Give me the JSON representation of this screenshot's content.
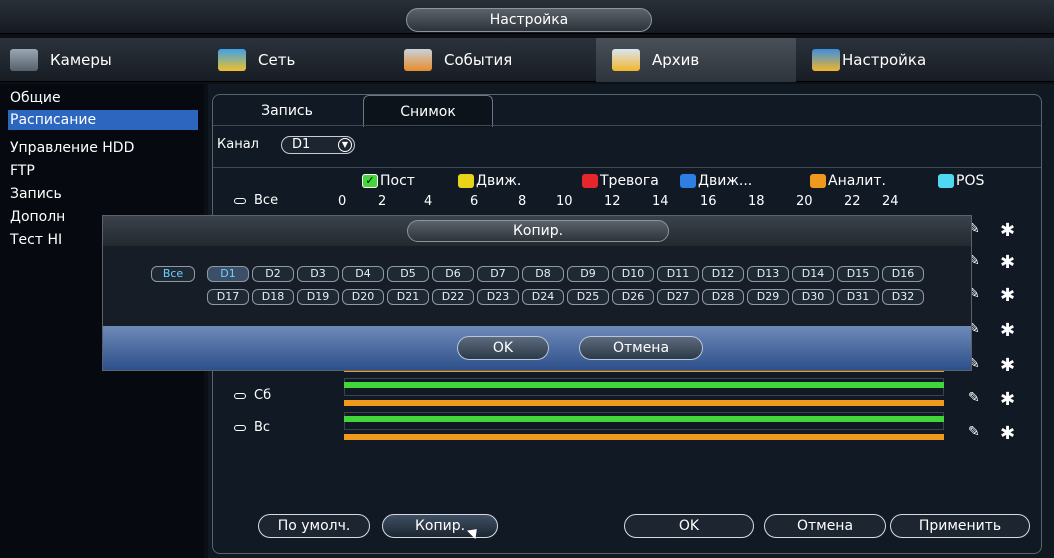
{
  "window": {
    "title": "Настройка"
  },
  "tabs": [
    {
      "label": "Камеры",
      "icon": "camera-icon",
      "active": false
    },
    {
      "label": "Сеть",
      "icon": "network-icon",
      "active": false
    },
    {
      "label": "События",
      "icon": "events-icon",
      "active": false
    },
    {
      "label": "Архив",
      "icon": "archive-icon",
      "active": true
    },
    {
      "label": "Настройка",
      "icon": "settings-icon",
      "active": false
    }
  ],
  "sidebar": {
    "items": [
      {
        "label": "Общие"
      },
      {
        "label": "Расписание",
        "active": true
      },
      {
        "label": "Управление HDD"
      },
      {
        "label": "FTP"
      },
      {
        "label": "Запись"
      },
      {
        "label": "Дополн"
      },
      {
        "label": "Тест HI"
      }
    ]
  },
  "subtabs": [
    {
      "label": "Запись",
      "active": false
    },
    {
      "label": "Снимок",
      "active": true
    }
  ],
  "channel": {
    "label": "Канал",
    "value": "D1"
  },
  "legend": [
    {
      "label": "Пост",
      "color": "#42d63a",
      "checked": true
    },
    {
      "label": "Движ.",
      "color": "#e8d51a"
    },
    {
      "label": "Тревога",
      "color": "#e5262a"
    },
    {
      "label": "Движ...",
      "color": "#2e7fe4"
    },
    {
      "label": "Аналит.",
      "color": "#ef9a1f"
    },
    {
      "label": "POS",
      "color": "#4fd8f2"
    }
  ],
  "schedule": {
    "all_label": "Все",
    "ticks": [
      "0",
      "2",
      "4",
      "6",
      "8",
      "10",
      "12",
      "14",
      "16",
      "18",
      "20",
      "22",
      "24"
    ],
    "days": [
      {
        "label": "Сб"
      },
      {
        "label": "Вс"
      }
    ]
  },
  "buttons": {
    "default": "По умолч.",
    "copy": "Копир.",
    "ok": "OK",
    "cancel": "Отмена",
    "apply": "Применить"
  },
  "copy_dialog": {
    "title": "Копир.",
    "all_label": "Все",
    "channels_row1": [
      "D1",
      "D2",
      "D3",
      "D4",
      "D5",
      "D6",
      "D7",
      "D8",
      "D9",
      "D10",
      "D11",
      "D12",
      "D13",
      "D14",
      "D15",
      "D16"
    ],
    "channels_row2": [
      "D17",
      "D18",
      "D19",
      "D20",
      "D21",
      "D22",
      "D23",
      "D24",
      "D25",
      "D26",
      "D27",
      "D28",
      "D29",
      "D30",
      "D31",
      "D32"
    ],
    "selected": "D1",
    "ok": "OK",
    "cancel": "Отмена"
  },
  "colors": {
    "accent": "#2c66bf",
    "record_green": "#42d63a",
    "record_orange": "#ef9a1f"
  }
}
